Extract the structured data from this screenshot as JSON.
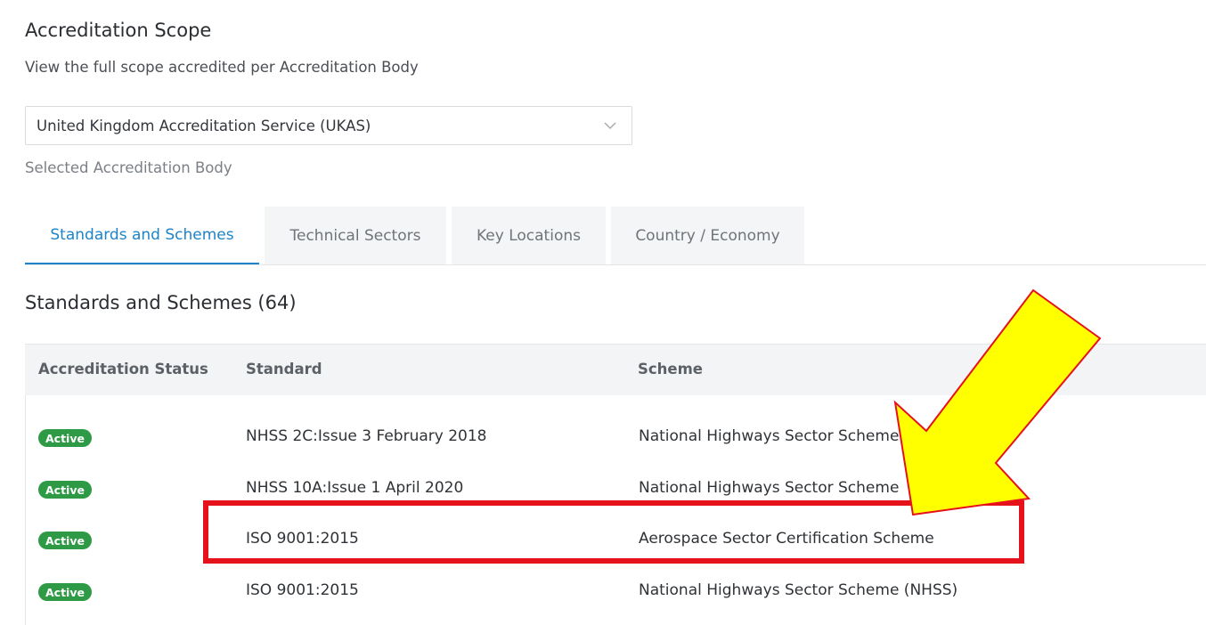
{
  "header": {
    "title": "Accreditation Scope",
    "subtitle": "View the full scope accredited per Accreditation Body"
  },
  "body_select": {
    "value": "United Kingdom Accreditation Service (UKAS)",
    "help_text": "Selected Accreditation Body"
  },
  "tabs": [
    {
      "label": "Standards and Schemes",
      "active": true
    },
    {
      "label": "Technical Sectors",
      "active": false
    },
    {
      "label": "Key Locations",
      "active": false
    },
    {
      "label": "Country / Economy",
      "active": false
    }
  ],
  "section": {
    "title": "Standards and Schemes (64)"
  },
  "table": {
    "columns": [
      "Accreditation Status",
      "Standard",
      "Scheme"
    ],
    "rows": [
      {
        "status": "Active",
        "standard": "NHSS 2C:Issue 3 February 2018",
        "scheme": "National Highways Sector Scheme"
      },
      {
        "status": "Active",
        "standard": "NHSS 10A:Issue 1 April 2020",
        "scheme": "National Highways Sector Scheme"
      },
      {
        "status": "Active",
        "standard": "ISO 9001:2015",
        "scheme": "Aerospace Sector Certification Scheme"
      },
      {
        "status": "Active",
        "standard": "ISO 9001:2015",
        "scheme": "National Highways Sector Scheme (NHSS)"
      }
    ]
  },
  "colors": {
    "accent": "#1d84c8",
    "status_active": "#2f9a45",
    "highlight": "#e6121b",
    "arrow_fill": "#ffff00"
  },
  "icons": {
    "select_chevron": "chevron-down-icon"
  }
}
